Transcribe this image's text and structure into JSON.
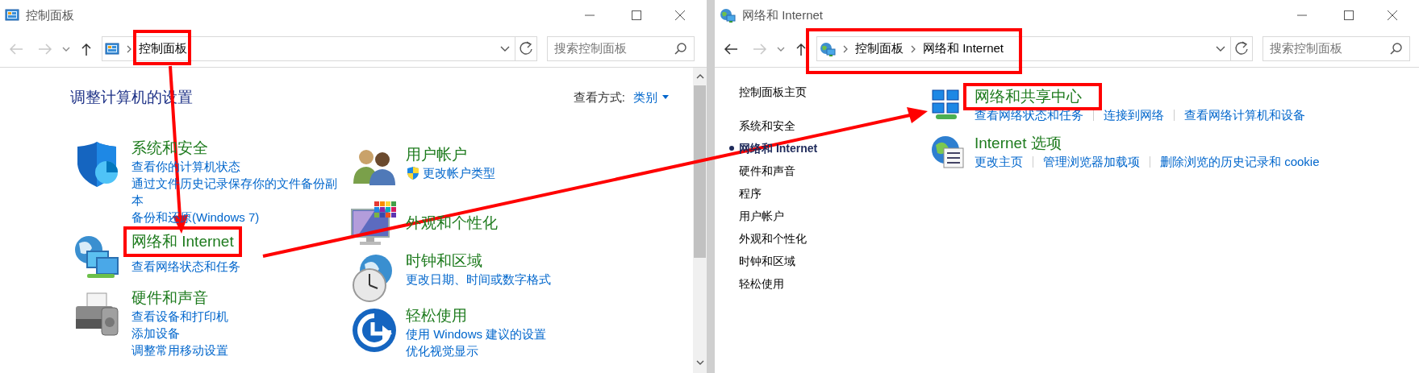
{
  "windows": [
    {
      "kind": "overview",
      "title": "控制面板",
      "nav": {
        "back_enabled": false,
        "forward_enabled": false
      },
      "address": {
        "highlighted": false,
        "crumbs": [
          {
            "label": "控制面板",
            "highlighted": true
          }
        ]
      },
      "search": {
        "placeholder": "搜索控制面板"
      },
      "heading": "调整计算机的设置",
      "view_by": {
        "label": "查看方式:",
        "value": "类别"
      },
      "columns": [
        [
          {
            "title": "系统和安全",
            "highlighted": false,
            "links": [
              "查看你的计算机状态",
              "通过文件历史记录保存你的文件备份副本",
              "备份和还原(Windows 7)"
            ]
          },
          {
            "title": "网络和 Internet",
            "highlighted": true,
            "links": [
              "查看网络状态和任务"
            ]
          },
          {
            "title": "硬件和声音",
            "highlighted": false,
            "links": [
              "查看设备和打印机",
              "添加设备",
              "调整常用移动设置"
            ]
          }
        ],
        [
          {
            "title": "用户帐户",
            "highlighted": false,
            "links": [
              "更改帐户类型"
            ]
          },
          {
            "title": "外观和个性化",
            "highlighted": false
          },
          {
            "title": "时钟和区域",
            "highlighted": false,
            "links": [
              "更改日期、时间或数字格式"
            ]
          },
          {
            "title": "轻松使用",
            "highlighted": false,
            "links": [
              "使用 Windows 建议的设置",
              "优化视觉显示"
            ]
          }
        ]
      ]
    },
    {
      "kind": "category",
      "title": "网络和 Internet",
      "nav": {
        "back_enabled": true,
        "forward_enabled": false
      },
      "address": {
        "highlighted": true,
        "crumbs": [
          {
            "label": "控制面板",
            "highlighted": false
          },
          {
            "label": "网络和 Internet",
            "highlighted": false
          }
        ]
      },
      "search": {
        "placeholder": "搜索控制面板"
      },
      "sidebar": {
        "home": "控制面板主页",
        "items": [
          {
            "label": "系统和安全",
            "selected": false
          },
          {
            "label": "网络和 Internet",
            "selected": true
          },
          {
            "label": "硬件和声音",
            "selected": false
          },
          {
            "label": "程序",
            "selected": false
          },
          {
            "label": "用户帐户",
            "selected": false
          },
          {
            "label": "外观和个性化",
            "selected": false
          },
          {
            "label": "时钟和区域",
            "selected": false
          },
          {
            "label": "轻松使用",
            "selected": false
          }
        ]
      },
      "sections": [
        {
          "title": "网络和共享中心",
          "highlighted": true,
          "links": [
            "查看网络状态和任务",
            "连接到网络",
            "查看网络计算机和设备"
          ]
        },
        {
          "title": "Internet 选项",
          "highlighted": false,
          "links": [
            "更改主页",
            "管理浏览器加载项",
            "删除浏览的历史记录和 cookie"
          ]
        }
      ]
    }
  ]
}
